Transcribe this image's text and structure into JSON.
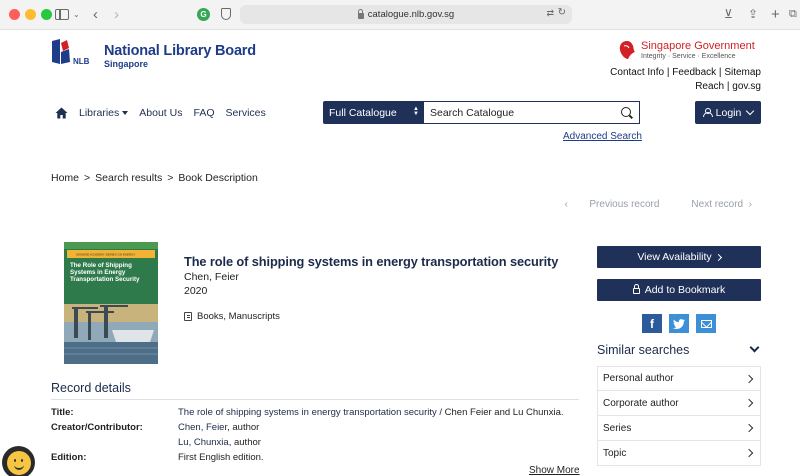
{
  "browser": {
    "url": "catalogue.nlb.gov.sg",
    "ext_icon": "G"
  },
  "header": {
    "brand_name": "National Library Board",
    "brand_sub": "Singapore",
    "logo_text": "NLB",
    "gov_name_1": "Singapore",
    "gov_name_2": "Government",
    "gov_tagline": "Integrity · Service · Excellence",
    "links": [
      "Contact Info",
      "Feedback",
      "Sitemap",
      "Reach",
      "gov.sg"
    ]
  },
  "nav": {
    "items": [
      "Libraries",
      "About Us",
      "FAQ",
      "Services"
    ],
    "catalogue_select": "Full Catalogue",
    "search_placeholder": "Search Catalogue",
    "advanced_search": "Advanced Search",
    "login": "Login"
  },
  "breadcrumb": [
    "Home",
    "Search results",
    "Book Description"
  ],
  "record_nav": {
    "previous": "Previous record",
    "next": "Next record"
  },
  "book": {
    "title": "The role of shipping systems in energy transportation security",
    "author": "Chen, Feier",
    "year": "2020",
    "format": "Books, Manuscripts",
    "cover_title": "The Role of Shipping Systems in Energy Transportation Security",
    "cover_band": "CHINESE ACADEMY SERIES ON ENERGY"
  },
  "actions": {
    "view_availability": "View Availability",
    "add_bookmark": "Add to Bookmark"
  },
  "similar": {
    "title": "Similar searches",
    "items": [
      "Personal author",
      "Corporate author",
      "Series",
      "Topic"
    ]
  },
  "record_details": {
    "title": "Record details",
    "rows": [
      {
        "label": "Title:",
        "value": "The role of shipping systems in energy transportation security",
        "suffix": " / Chen Feier and Lu Chunxia."
      },
      {
        "label": "Creator/Contributor:",
        "value": "Chen, Feier",
        "suffix": ", author"
      },
      {
        "label": "",
        "value": "Lu, Chunxia",
        "suffix": ", author"
      },
      {
        "label": "Edition:",
        "value": "First English edition.",
        "suffix": ""
      }
    ],
    "show_more": "Show More"
  }
}
